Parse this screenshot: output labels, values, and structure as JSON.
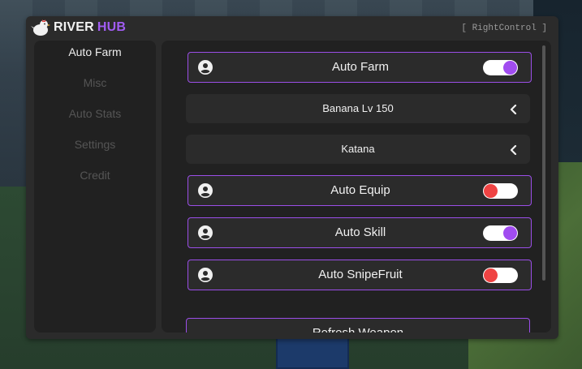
{
  "window": {
    "title_main": "RIVER",
    "title_accent": "HUB",
    "keybind": "[ RightControl ]"
  },
  "colors": {
    "accent": "#9b4ee8",
    "toggle_on": "#a14cf0",
    "toggle_off": "#ef4343",
    "panel": "#212121",
    "row": "#2b2b2b"
  },
  "sidebar": {
    "items": [
      {
        "label": "Auto Farm",
        "active": true
      },
      {
        "label": "Misc",
        "active": false
      },
      {
        "label": "Auto Stats",
        "active": false
      },
      {
        "label": "Settings",
        "active": false
      },
      {
        "label": "Credit",
        "active": false
      }
    ]
  },
  "main": {
    "rows": [
      {
        "kind": "toggle",
        "label": "Auto Farm",
        "icon": "user-circle-icon",
        "state": "on"
      },
      {
        "kind": "dropdown",
        "label": "Banana Lv 150",
        "icon": "chevron-left-icon"
      },
      {
        "kind": "dropdown",
        "label": "Katana",
        "icon": "chevron-left-icon"
      },
      {
        "kind": "toggle",
        "label": "Auto Equip",
        "icon": "user-circle-icon",
        "state": "off"
      },
      {
        "kind": "toggle",
        "label": "Auto Skill",
        "icon": "user-circle-icon",
        "state": "on"
      },
      {
        "kind": "toggle",
        "label": "Auto SnipeFruit",
        "icon": "user-circle-icon",
        "state": "off"
      }
    ],
    "refresh_label": "Refresh Weapon"
  }
}
